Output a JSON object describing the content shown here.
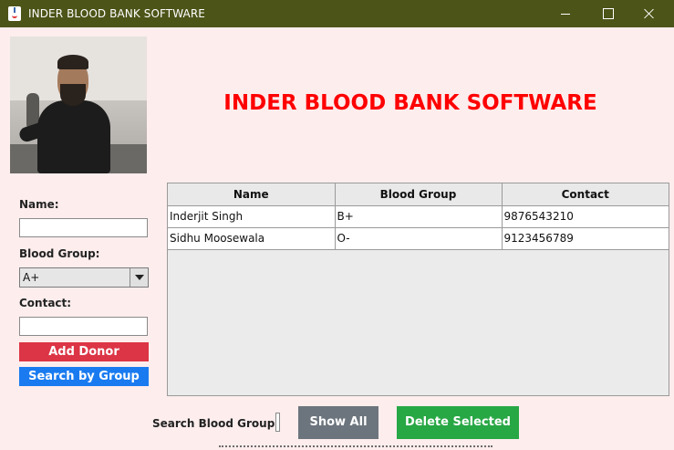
{
  "window": {
    "title": "INDER BLOOD BANK SOFTWARE"
  },
  "header": {
    "heading": "INDER BLOOD BANK SOFTWARE",
    "heading_color": "#ff0000"
  },
  "form": {
    "name_label": "Name:",
    "name_value": "",
    "blood_group_label": "Blood Group:",
    "blood_group_selected": "A+",
    "contact_label": "Contact:",
    "contact_value": "",
    "add_button": "Add Donor",
    "search_button": "Search by Group"
  },
  "table": {
    "columns": [
      "Name",
      "Blood Group",
      "Contact"
    ],
    "rows": [
      [
        "Inderjit Singh",
        "B+",
        "9876543210"
      ],
      [
        "Sidhu Moosewala",
        "O-",
        "9123456789"
      ]
    ]
  },
  "bottom": {
    "search_label": "Search Blood Group:",
    "search_value": "",
    "show_all_button": "Show All",
    "delete_button": "Delete Selected"
  },
  "colors": {
    "background": "#fdeded",
    "titlebar": "#4d5418",
    "add_button": "#dc3545",
    "search_button": "#1a7bf0",
    "show_all_button": "#6c757d",
    "delete_button": "#28a745"
  }
}
